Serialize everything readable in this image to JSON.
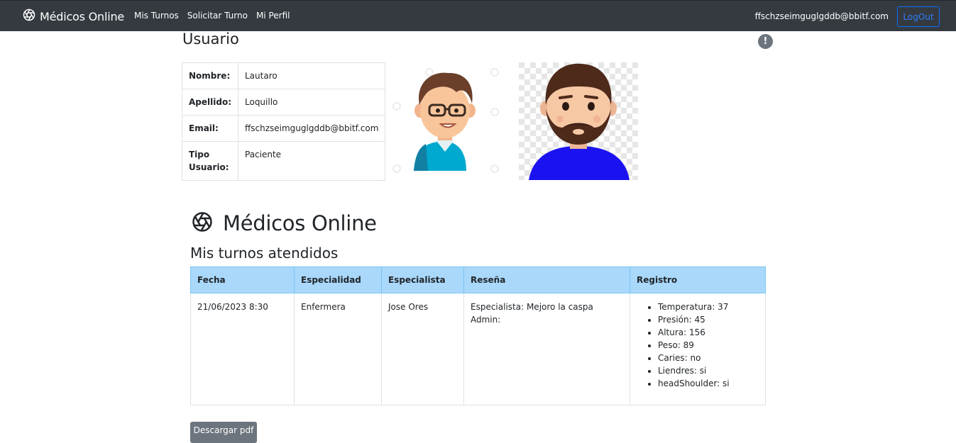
{
  "navbar": {
    "brand": "Médicos Online",
    "brand_icon": "aperture-icon",
    "links": [
      "Mis Turnos",
      "Solicitar Turno",
      "Mi Perfil"
    ],
    "user_email": "ffschzseimguglgddb@bbitf.com",
    "logout_label": "LogOut"
  },
  "user": {
    "title": "Usuario",
    "rows": [
      {
        "key": "Nombre:",
        "value": "Lautaro"
      },
      {
        "key": "Apellido:",
        "value": "Loquillo"
      },
      {
        "key": "Email:",
        "value": "ffschzseimguglgddb@bbitf.com"
      },
      {
        "key": "Tipo Usuario:",
        "value": "Paciente"
      }
    ],
    "info_icon": "exclamation-circle-icon"
  },
  "history": {
    "brand": "Médicos Online",
    "title": "Mis turnos atendidos",
    "headers": [
      "Fecha",
      "Especialidad",
      "Especialista",
      "Reseña",
      "Registro"
    ],
    "rows": [
      {
        "fecha": "21/06/2023 8:30",
        "especialidad": "Enfermera",
        "especialista": "Jose Ores",
        "resena_especialista": "Especialista: Mejoro la caspa",
        "resena_admin": "Admin:",
        "registro": [
          "Temperatura: 37",
          "Presión: 45",
          "Altura: 156",
          "Peso: 89",
          "Caries: no",
          "Liendres: si",
          "headShoulder: si"
        ]
      }
    ],
    "download_label": "Descargar pdf"
  },
  "colors": {
    "navbar": "#343a40",
    "table_header": "#a9d8fb",
    "logout_border": "#0d6efd",
    "button_secondary": "#6c757d"
  }
}
